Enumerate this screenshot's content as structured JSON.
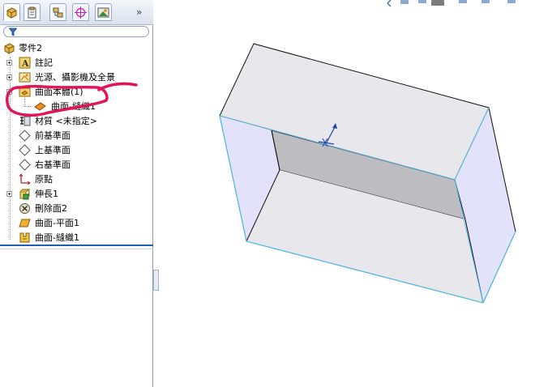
{
  "feature_tree": {
    "part_name": "零件2",
    "items": [
      {
        "label": "註記"
      },
      {
        "label": "光源、攝影機及全景"
      },
      {
        "label": "曲面本體(1)"
      },
      {
        "label": "曲面-縫織1"
      },
      {
        "label": "材質 <未指定>"
      },
      {
        "label": "前基準面"
      },
      {
        "label": "上基準面"
      },
      {
        "label": "右基準面"
      },
      {
        "label": "原點"
      },
      {
        "label": "伸長1"
      },
      {
        "label": "刪除面2"
      },
      {
        "label": "曲面-平面1"
      },
      {
        "label": "曲面-縫織1"
      }
    ],
    "more_tabs": "»"
  },
  "colors": {
    "annotation": "#e0155a",
    "selection_edge": "#55b8e0",
    "face_light": "#e8e8ec",
    "face_side": "#e2e2fb",
    "face_inner": "#bdbdc1",
    "panel_accent": "#1f5fb4"
  },
  "icons": [
    "part-icon",
    "property-tab-icon",
    "configuration-tab-icon",
    "dimxpert-tab-icon",
    "display-tab-icon",
    "filter-icon"
  ]
}
